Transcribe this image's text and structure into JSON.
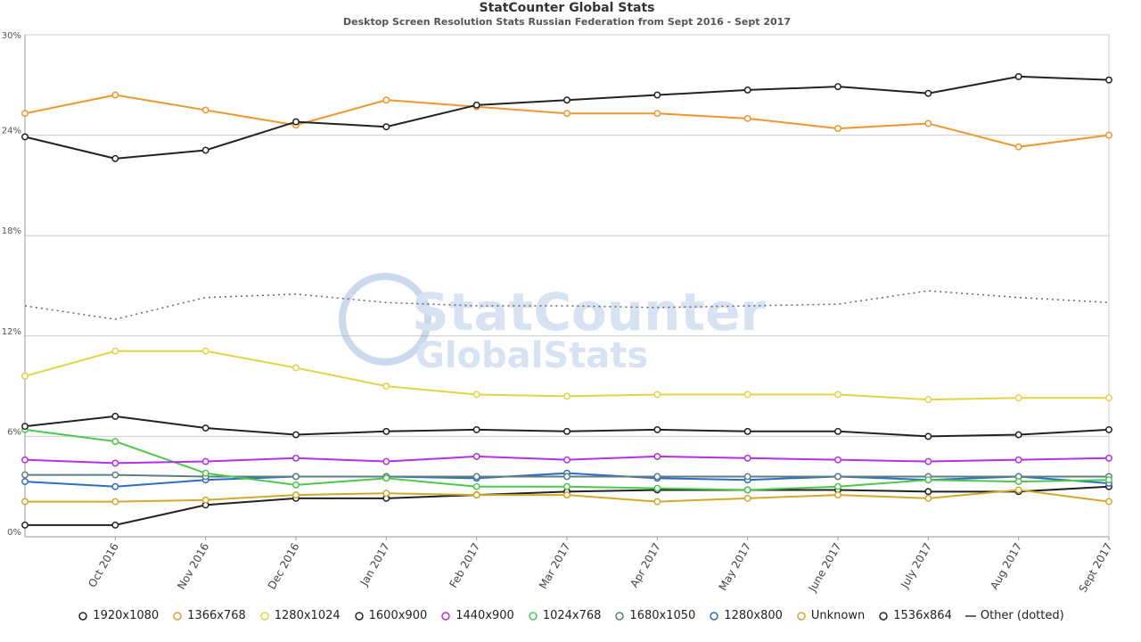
{
  "chart_data": {
    "type": "line",
    "title": "StatCounter Global Stats",
    "subtitle": "Desktop Screen Resolution Stats Russian Federation from Sept 2016 - Sept 2017",
    "watermark": "StatCounter GlobalStats",
    "x": [
      "Sept 2016",
      "Oct 2016",
      "Nov 2016",
      "Dec 2016",
      "Jan 2017",
      "Feb 2017",
      "Mar 2017",
      "Apr 2017",
      "May 2017",
      "June 2017",
      "July 2017",
      "Aug 2017",
      "Sept 2017"
    ],
    "x_tick_labels": [
      "Oct 2016",
      "Nov 2016",
      "Dec 2016",
      "Jan 2017",
      "Feb 2017",
      "Mar 2017",
      "Apr 2017",
      "May 2017",
      "June 2017",
      "July 2017",
      "Aug 2017",
      "Sept 2017"
    ],
    "y_ticks": [
      "0%",
      "6%",
      "12%",
      "18%",
      "24%",
      "30%"
    ],
    "ylim": [
      0,
      30
    ],
    "grid": true,
    "legend_placement": "bottom",
    "series": [
      {
        "name": "1920x1080",
        "color": "#222222",
        "values": [
          23.9,
          22.6,
          23.1,
          24.8,
          24.5,
          25.8,
          26.1,
          26.4,
          26.7,
          26.9,
          26.5,
          27.5,
          27.3
        ]
      },
      {
        "name": "1366x768",
        "color": "#f0962f",
        "values": [
          25.3,
          26.4,
          25.5,
          24.6,
          26.1,
          25.7,
          25.3,
          25.3,
          25.0,
          24.4,
          24.7,
          23.3,
          24.0
        ]
      },
      {
        "name": "1280x1024",
        "color": "#e3d446",
        "values": [
          9.6,
          11.1,
          11.1,
          10.1,
          9.0,
          8.5,
          8.4,
          8.5,
          8.5,
          8.5,
          8.2,
          8.3,
          8.3
        ]
      },
      {
        "name": "1600x900",
        "color": "#222222",
        "values": [
          6.6,
          7.2,
          6.5,
          6.1,
          6.3,
          6.4,
          6.3,
          6.4,
          6.3,
          6.3,
          6.0,
          6.1,
          6.4
        ]
      },
      {
        "name": "1440x900",
        "color": "#b52fe6",
        "values": [
          4.6,
          4.4,
          4.5,
          4.7,
          4.5,
          4.8,
          4.6,
          4.8,
          4.7,
          4.6,
          4.5,
          4.6,
          4.7
        ]
      },
      {
        "name": "1024x768",
        "color": "#4cc94c",
        "values": [
          6.4,
          5.7,
          3.8,
          3.1,
          3.5,
          3.0,
          3.0,
          2.9,
          2.8,
          3.0,
          3.4,
          3.3,
          3.4
        ]
      },
      {
        "name": "1680x1050",
        "color": "#5e7f80",
        "values": [
          3.7,
          3.7,
          3.6,
          3.6,
          3.6,
          3.6,
          3.6,
          3.6,
          3.6,
          3.6,
          3.6,
          3.6,
          3.6
        ]
      },
      {
        "name": "1280x800",
        "color": "#2f6dc2",
        "values": [
          3.3,
          3.0,
          3.4,
          3.6,
          3.6,
          3.5,
          3.8,
          3.5,
          3.4,
          3.6,
          3.4,
          3.6,
          3.2
        ]
      },
      {
        "name": "Unknown",
        "color": "#d4a82a",
        "values": [
          2.1,
          2.1,
          2.2,
          2.5,
          2.6,
          2.5,
          2.5,
          2.1,
          2.3,
          2.5,
          2.3,
          2.8,
          2.1
        ]
      },
      {
        "name": "1536x864",
        "color": "#222222",
        "values": [
          0.7,
          0.7,
          1.9,
          2.3,
          2.3,
          2.5,
          2.7,
          2.8,
          2.8,
          2.8,
          2.7,
          2.7,
          3.0
        ]
      },
      {
        "name": "Other (dotted)",
        "color": "#666666",
        "dotted": true,
        "values": [
          13.8,
          13.0,
          14.3,
          14.5,
          14.0,
          13.8,
          13.8,
          13.7,
          13.8,
          13.9,
          14.7,
          14.3,
          14.0
        ]
      }
    ]
  }
}
